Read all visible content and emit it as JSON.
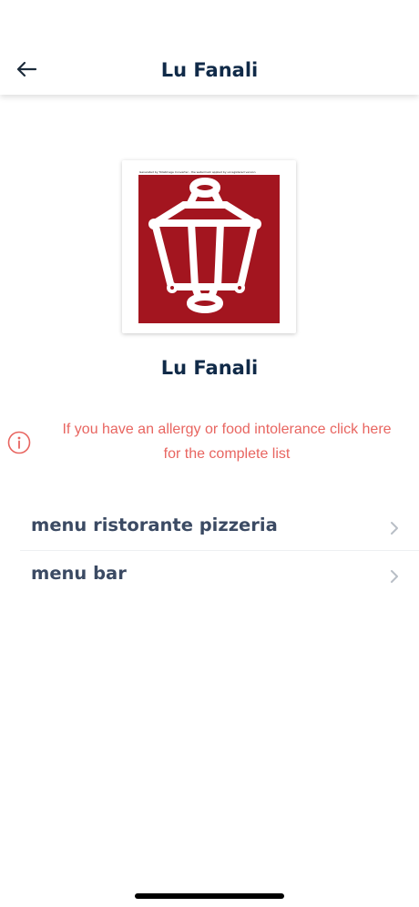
{
  "header": {
    "title": "Lu Fanali",
    "back_icon": "arrow-left-icon"
  },
  "logo": {
    "caption_strip": "Generated by TotalImage Converter - the watermark applied by unregistered version",
    "background_color": "#a3151f",
    "icon": "street-lantern-icon"
  },
  "restaurant": {
    "name": "Lu Fanali"
  },
  "allergy_notice": {
    "icon": "info-icon",
    "line1": "If you have an allergy or food intolerance click here",
    "line2": "for the complete list",
    "color": "#e86560"
  },
  "menus": [
    {
      "label": "menu ristorante pizzeria",
      "icon": "chevron-right-icon"
    },
    {
      "label": "menu bar",
      "icon": "chevron-right-icon"
    }
  ],
  "colors": {
    "title": "#102a48",
    "menu_text": "#3b4a63",
    "chevron": "#b8bec6"
  }
}
